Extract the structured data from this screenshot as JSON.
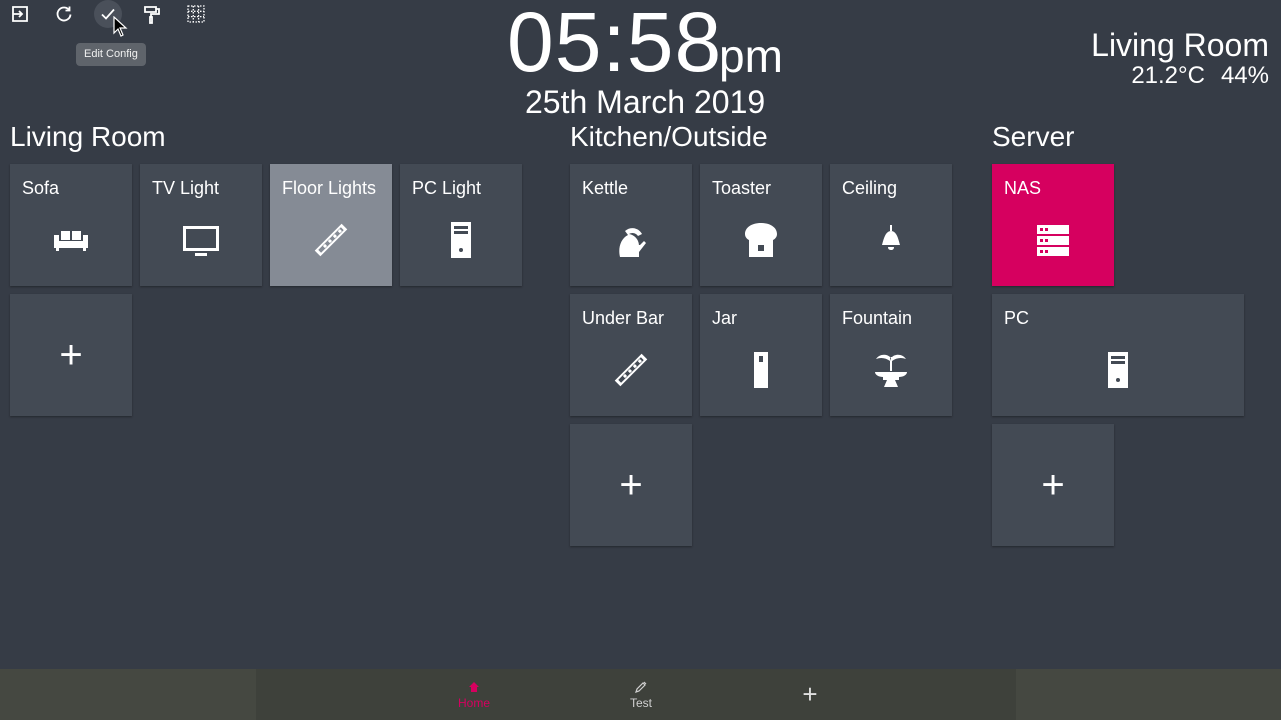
{
  "toolbar": {
    "tooltip": "Edit Config",
    "buttons": [
      "exit-icon",
      "refresh-icon",
      "check-icon",
      "paint-roller-icon",
      "grid-icon"
    ]
  },
  "clock": {
    "time": "05:58",
    "ampm": "pm",
    "date": "25th March 2019"
  },
  "room": {
    "name": "Living Room",
    "temperature": "21.2°C",
    "humidity": "44%"
  },
  "groups": [
    {
      "title": "Living Room",
      "tiles": [
        {
          "label": "Sofa",
          "icon": "sofa-icon",
          "state": "off"
        },
        {
          "label": "TV Light",
          "icon": "tv-icon",
          "state": "off"
        },
        {
          "label": "Floor Lights",
          "icon": "led-strip-icon",
          "state": "on"
        },
        {
          "label": "PC Light",
          "icon": "desktop-tower-icon",
          "state": "off"
        }
      ],
      "add_label": "+"
    },
    {
      "title": "Kitchen/Outside",
      "tiles": [
        {
          "label": "Kettle",
          "icon": "kettle-icon",
          "state": "off"
        },
        {
          "label": "Toaster",
          "icon": "toaster-icon",
          "state": "off"
        },
        {
          "label": "Ceiling",
          "icon": "ceiling-light-icon",
          "state": "off"
        },
        {
          "label": "Under Bar",
          "icon": "led-strip-icon",
          "state": "off"
        },
        {
          "label": "Jar",
          "icon": "jar-icon",
          "state": "off"
        },
        {
          "label": "Fountain",
          "icon": "fountain-icon",
          "state": "off"
        }
      ],
      "add_label": "+"
    },
    {
      "title": "Server",
      "tiles": [
        {
          "label": "NAS",
          "icon": "server-icon",
          "state": "on"
        },
        {
          "label": "PC",
          "icon": "desktop-tower-icon",
          "state": "off"
        }
      ],
      "add_label": "+"
    }
  ],
  "bottom_nav": {
    "items": [
      {
        "label": "Home",
        "icon": "home-icon",
        "active": true
      },
      {
        "label": "Test",
        "icon": "pencil-icon",
        "active": false
      }
    ],
    "add_label": "+"
  },
  "colors": {
    "background": "#363c46",
    "tile": "#434a54",
    "tile_on_light": "#858b95",
    "accent": "#d6005f"
  }
}
